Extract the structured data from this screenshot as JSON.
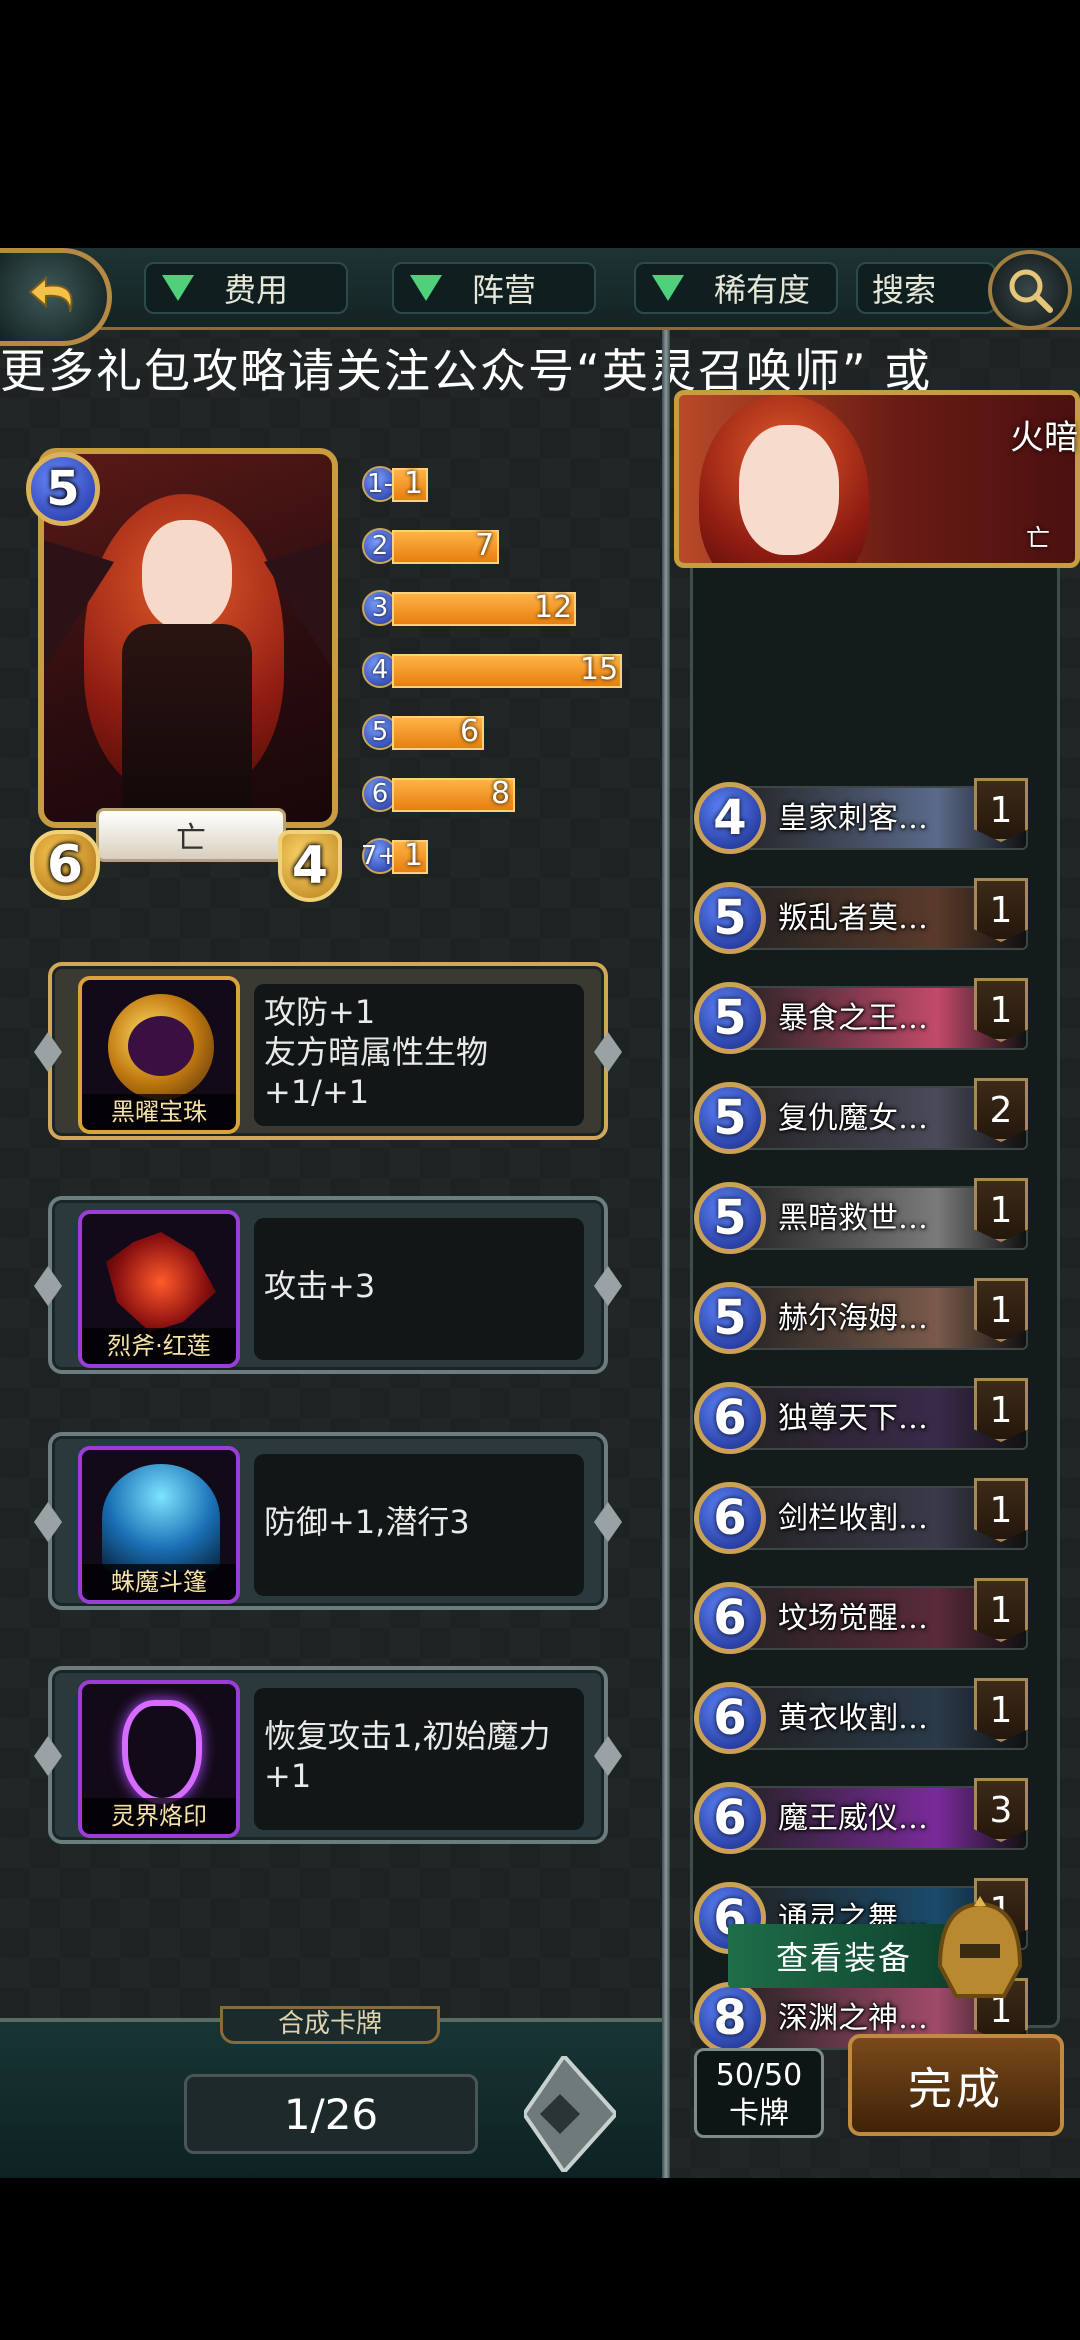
{
  "filters": {
    "cost_label": "费用",
    "faction_label": "阵营",
    "rarity_label": "稀有度",
    "search_label": "搜索"
  },
  "marquee": "更多礼包攻略请关注公众号“英灵召唤师” 或",
  "hero": {
    "name": "火暗",
    "faction": "亡"
  },
  "selected_card": {
    "cost": "5",
    "attack": "6",
    "health": "4",
    "faction": "亡"
  },
  "mana_curve": [
    {
      "cost_label": "1-",
      "count": 1
    },
    {
      "cost_label": "2",
      "count": 7
    },
    {
      "cost_label": "3",
      "count": 12
    },
    {
      "cost_label": "4",
      "count": 15
    },
    {
      "cost_label": "5",
      "count": 6
    },
    {
      "cost_label": "6",
      "count": 8
    },
    {
      "cost_label": "7+",
      "count": 1
    }
  ],
  "equipment": [
    {
      "name": "黑曜宝珠",
      "desc": "攻防+1\n友方暗属性生物+1/+1"
    },
    {
      "name": "烈斧·红莲",
      "desc": "攻击+3"
    },
    {
      "name": "蛛魔斗篷",
      "desc": "防御+1,潜行3"
    },
    {
      "name": "灵界烙印",
      "desc": "恢复攻击1,初始魔力+1"
    }
  ],
  "deck": [
    {
      "cost": "4",
      "name": "皇家刺客…",
      "count": "1"
    },
    {
      "cost": "5",
      "name": "叛乱者莫…",
      "count": "1"
    },
    {
      "cost": "5",
      "name": "暴食之王…",
      "count": "1"
    },
    {
      "cost": "5",
      "name": "复仇魔女…",
      "count": "2"
    },
    {
      "cost": "5",
      "name": "黑暗救世…",
      "count": "1"
    },
    {
      "cost": "5",
      "name": "赫尔海姆…",
      "count": "1"
    },
    {
      "cost": "6",
      "name": "独尊天下…",
      "count": "1"
    },
    {
      "cost": "6",
      "name": "剑栏收割…",
      "count": "1"
    },
    {
      "cost": "6",
      "name": "坟场觉醒…",
      "count": "1"
    },
    {
      "cost": "6",
      "name": "黄衣收割…",
      "count": "1"
    },
    {
      "cost": "6",
      "name": "魔王威仪…",
      "count": "3"
    },
    {
      "cost": "6",
      "name": "通灵之舞…",
      "count": "1"
    },
    {
      "cost": "8",
      "name": "深渊之神…",
      "count": "1"
    }
  ],
  "bottom": {
    "compose_label": "合成卡牌",
    "page": "1/26",
    "view_equipment": "查看装备",
    "card_count": "50/50",
    "card_count_label": "卡牌",
    "done": "完成"
  },
  "colors": {
    "accent_gold": "#c89c40",
    "filter_arrow": "#4fd17b",
    "bar_orange": "#f09a2a"
  }
}
